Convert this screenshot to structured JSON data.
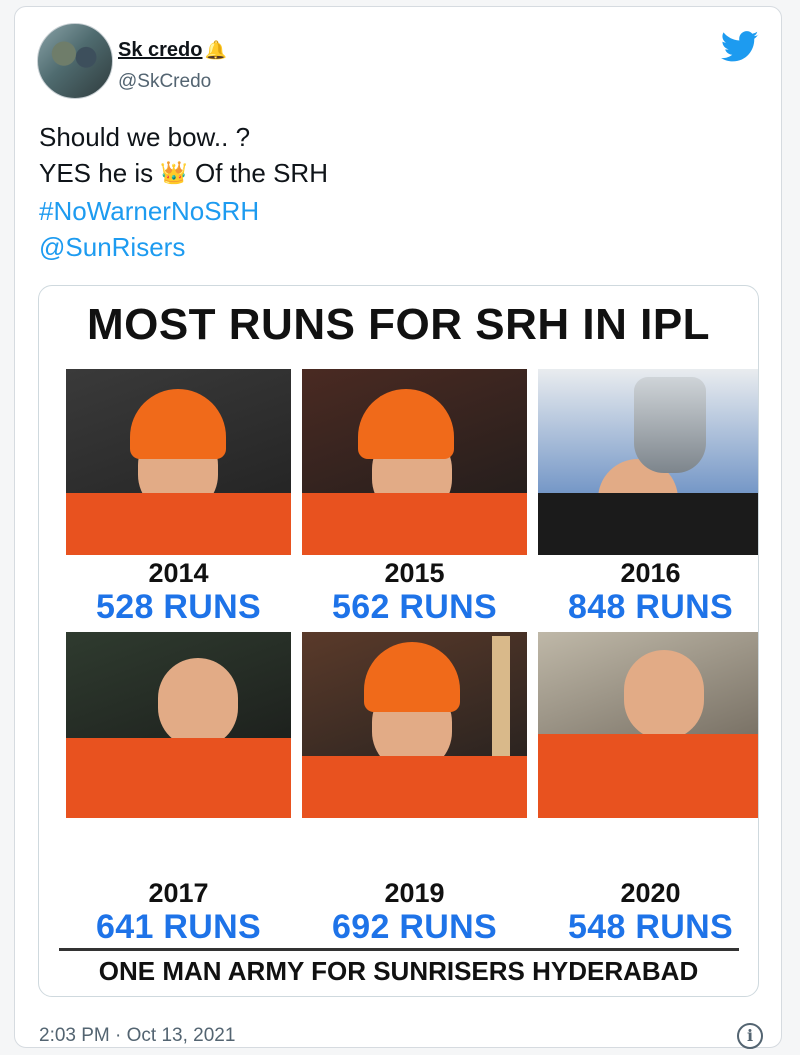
{
  "author": {
    "name": "Sk credo",
    "handle": "@SkCredo"
  },
  "tweet": {
    "line1": "Should we bow.. ?",
    "line2_before": "YES he is",
    "line2_after": "Of the SRH",
    "hashtag": "#NoWarnerNoSRH",
    "mention": "@SunRisers"
  },
  "graphic": {
    "title": "MOST RUNS FOR SRH IN IPL",
    "stats": [
      {
        "year": "2014",
        "runs": "528 RUNS"
      },
      {
        "year": "2015",
        "runs": "562 RUNS"
      },
      {
        "year": "2016",
        "runs": "848 RUNS"
      },
      {
        "year": "2017",
        "runs": "641 RUNS"
      },
      {
        "year": "2019",
        "runs": "692 RUNS"
      },
      {
        "year": "2020",
        "runs": "548 RUNS"
      }
    ],
    "footer": "ONE MAN ARMY FOR SUNRISERS HYDERABAD"
  },
  "timestamp": "2:03 PM · Oct 13, 2021",
  "icons": {
    "bell": "bell-icon",
    "crown": "crown-icon",
    "twitter": "twitter-bird-icon",
    "info": "info-icon"
  },
  "colors": {
    "link": "#1d9bf0",
    "runs": "#1e73e8",
    "jersey": "#e8521f"
  }
}
